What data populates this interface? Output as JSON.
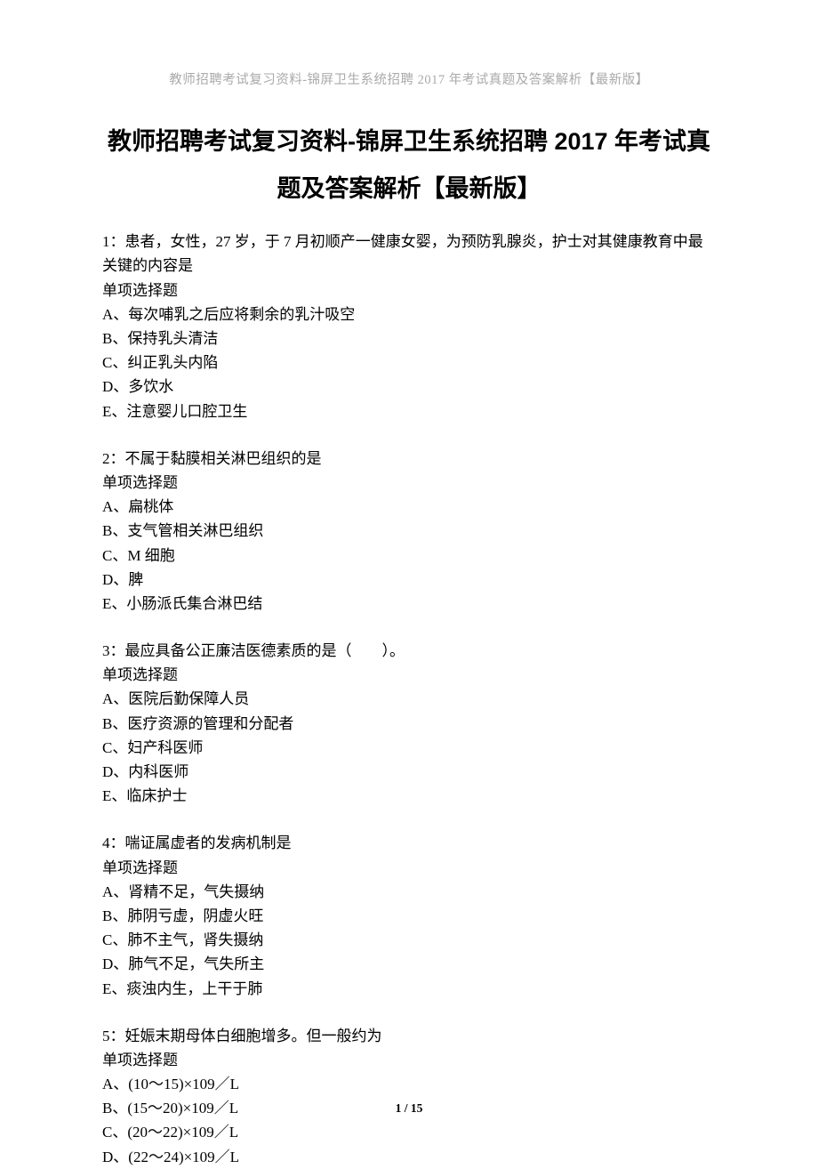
{
  "running_header": "教师招聘考试复习资料-锦屏卫生系统招聘 2017 年考试真题及答案解析【最新版】",
  "title_line1": "教师招聘考试复习资料-锦屏卫生系统招聘 2017 年考试真",
  "title_line2": "题及答案解析【最新版】",
  "page_number": "1 / 15",
  "questions": [
    {
      "stem": "1：患者，女性，27 岁，于 7 月初顺产一健康女婴，为预防乳腺炎，护士对其健康教育中最关键的内容是",
      "type": "单项选择题",
      "options": [
        "A、每次哺乳之后应将剩余的乳汁吸空",
        "B、保持乳头清洁",
        "C、纠正乳头内陷",
        "D、多饮水",
        "E、注意婴儿口腔卫生"
      ]
    },
    {
      "stem": "2：不属于黏膜相关淋巴组织的是",
      "type": "单项选择题",
      "options": [
        "A、扁桃体",
        "B、支气管相关淋巴组织",
        "C、M 细胞",
        "D、脾",
        "E、小肠派氏集合淋巴结"
      ]
    },
    {
      "stem": "3：最应具备公正廉洁医德素质的是（　　）。",
      "type": "单项选择题",
      "options": [
        "A、医院后勤保障人员",
        "B、医疗资源的管理和分配者",
        "C、妇产科医师",
        "D、内科医师",
        "E、临床护士"
      ]
    },
    {
      "stem": "4：喘证属虚者的发病机制是",
      "type": "单项选择题",
      "options": [
        "A、肾精不足，气失摄纳",
        "B、肺阴亏虚，阴虚火旺",
        "C、肺不主气，肾失摄纳",
        "D、肺气不足，气失所主",
        "E、痰浊内生，上干于肺"
      ]
    },
    {
      "stem": "5：妊娠末期母体白细胞增多。但一般约为",
      "type": "单项选择题",
      "options": [
        "A、(10～15)×109／L",
        "B、(15～20)×109／L",
        "C、(20～22)×109／L",
        "D、(22～24)×109／L"
      ]
    }
  ]
}
